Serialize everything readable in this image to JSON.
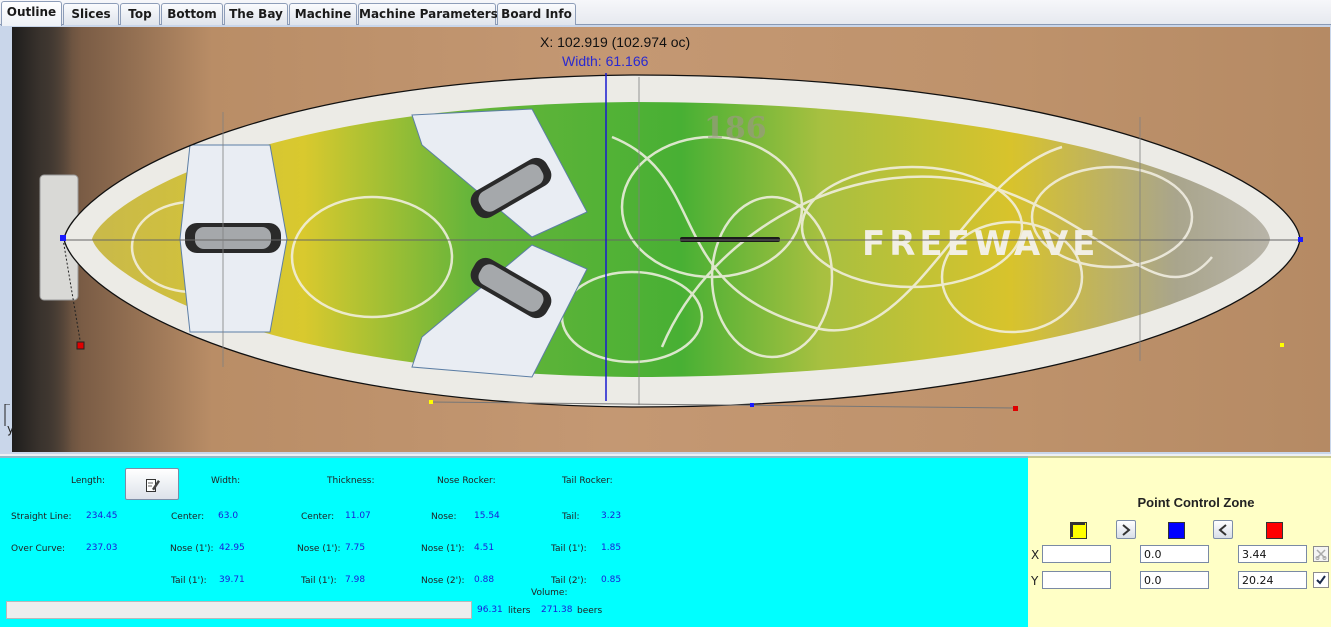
{
  "tabs": [
    {
      "label": "Outline",
      "active": true
    },
    {
      "label": "Slices",
      "active": false
    },
    {
      "label": "Top",
      "active": false
    },
    {
      "label": "Bottom",
      "active": false
    },
    {
      "label": "The Bay",
      "active": false
    },
    {
      "label": "Machine",
      "active": false
    },
    {
      "label": "Machine Parameters",
      "active": false
    },
    {
      "label": "Board Info",
      "active": false
    }
  ],
  "canvas": {
    "x_readout": "X: 102.919 (102.974 oc)",
    "width_readout": "Width: 61.166",
    "axis_y": "y",
    "board_print": "186",
    "board_brand": "FREEWAVE"
  },
  "info": {
    "length_label": "Length:",
    "width_label": "Width:",
    "thickness_label": "Thickness:",
    "nose_rocker_label": "Nose Rocker:",
    "tail_rocker_label": "Tail Rocker:",
    "straight_line_label": "Straight Line:",
    "straight_line_value": "234.45",
    "over_curve_label": "Over Curve:",
    "over_curve_value": "237.03",
    "width_center_label": "Center:",
    "width_center_value": "63.0",
    "width_nose1_label": "Nose (1'):",
    "width_nose1_value": "42.95",
    "width_tail1_label": "Tail (1'):",
    "width_tail1_value": "39.71",
    "thick_center_label": "Center:",
    "thick_center_value": "11.07",
    "thick_nose1_label": "Nose (1'):",
    "thick_nose1_value": "7.75",
    "thick_tail1_label": "Tail (1'):",
    "thick_tail1_value": "7.98",
    "nr_nose_label": "Nose:",
    "nr_nose_value": "15.54",
    "nr_nose1_label": "Nose (1'):",
    "nr_nose1_value": "4.51",
    "nr_nose2_label": "Nose (2'):",
    "nr_nose2_value": "0.88",
    "tr_tail_label": "Tail:",
    "tr_tail_value": "3.23",
    "tr_tail1_label": "Tail (1'):",
    "tr_tail1_value": "1.85",
    "tr_tail2_label": "Tail (2'):",
    "tr_tail2_value": "0.85",
    "volume_label": "Volume:",
    "volume_liters": "96.31",
    "liters_unit": "liters",
    "volume_beers": "271.38",
    "beers_unit": "beers"
  },
  "point_control": {
    "title": "Point Control Zone",
    "x_label": "X",
    "y_label": "Y",
    "x_values": [
      "",
      "0.0",
      "3.44"
    ],
    "y_values": [
      "",
      "0.0",
      "20.24"
    ],
    "swatch_colors": [
      "#ffff00",
      "#0000ff",
      "#ff0000"
    ]
  }
}
